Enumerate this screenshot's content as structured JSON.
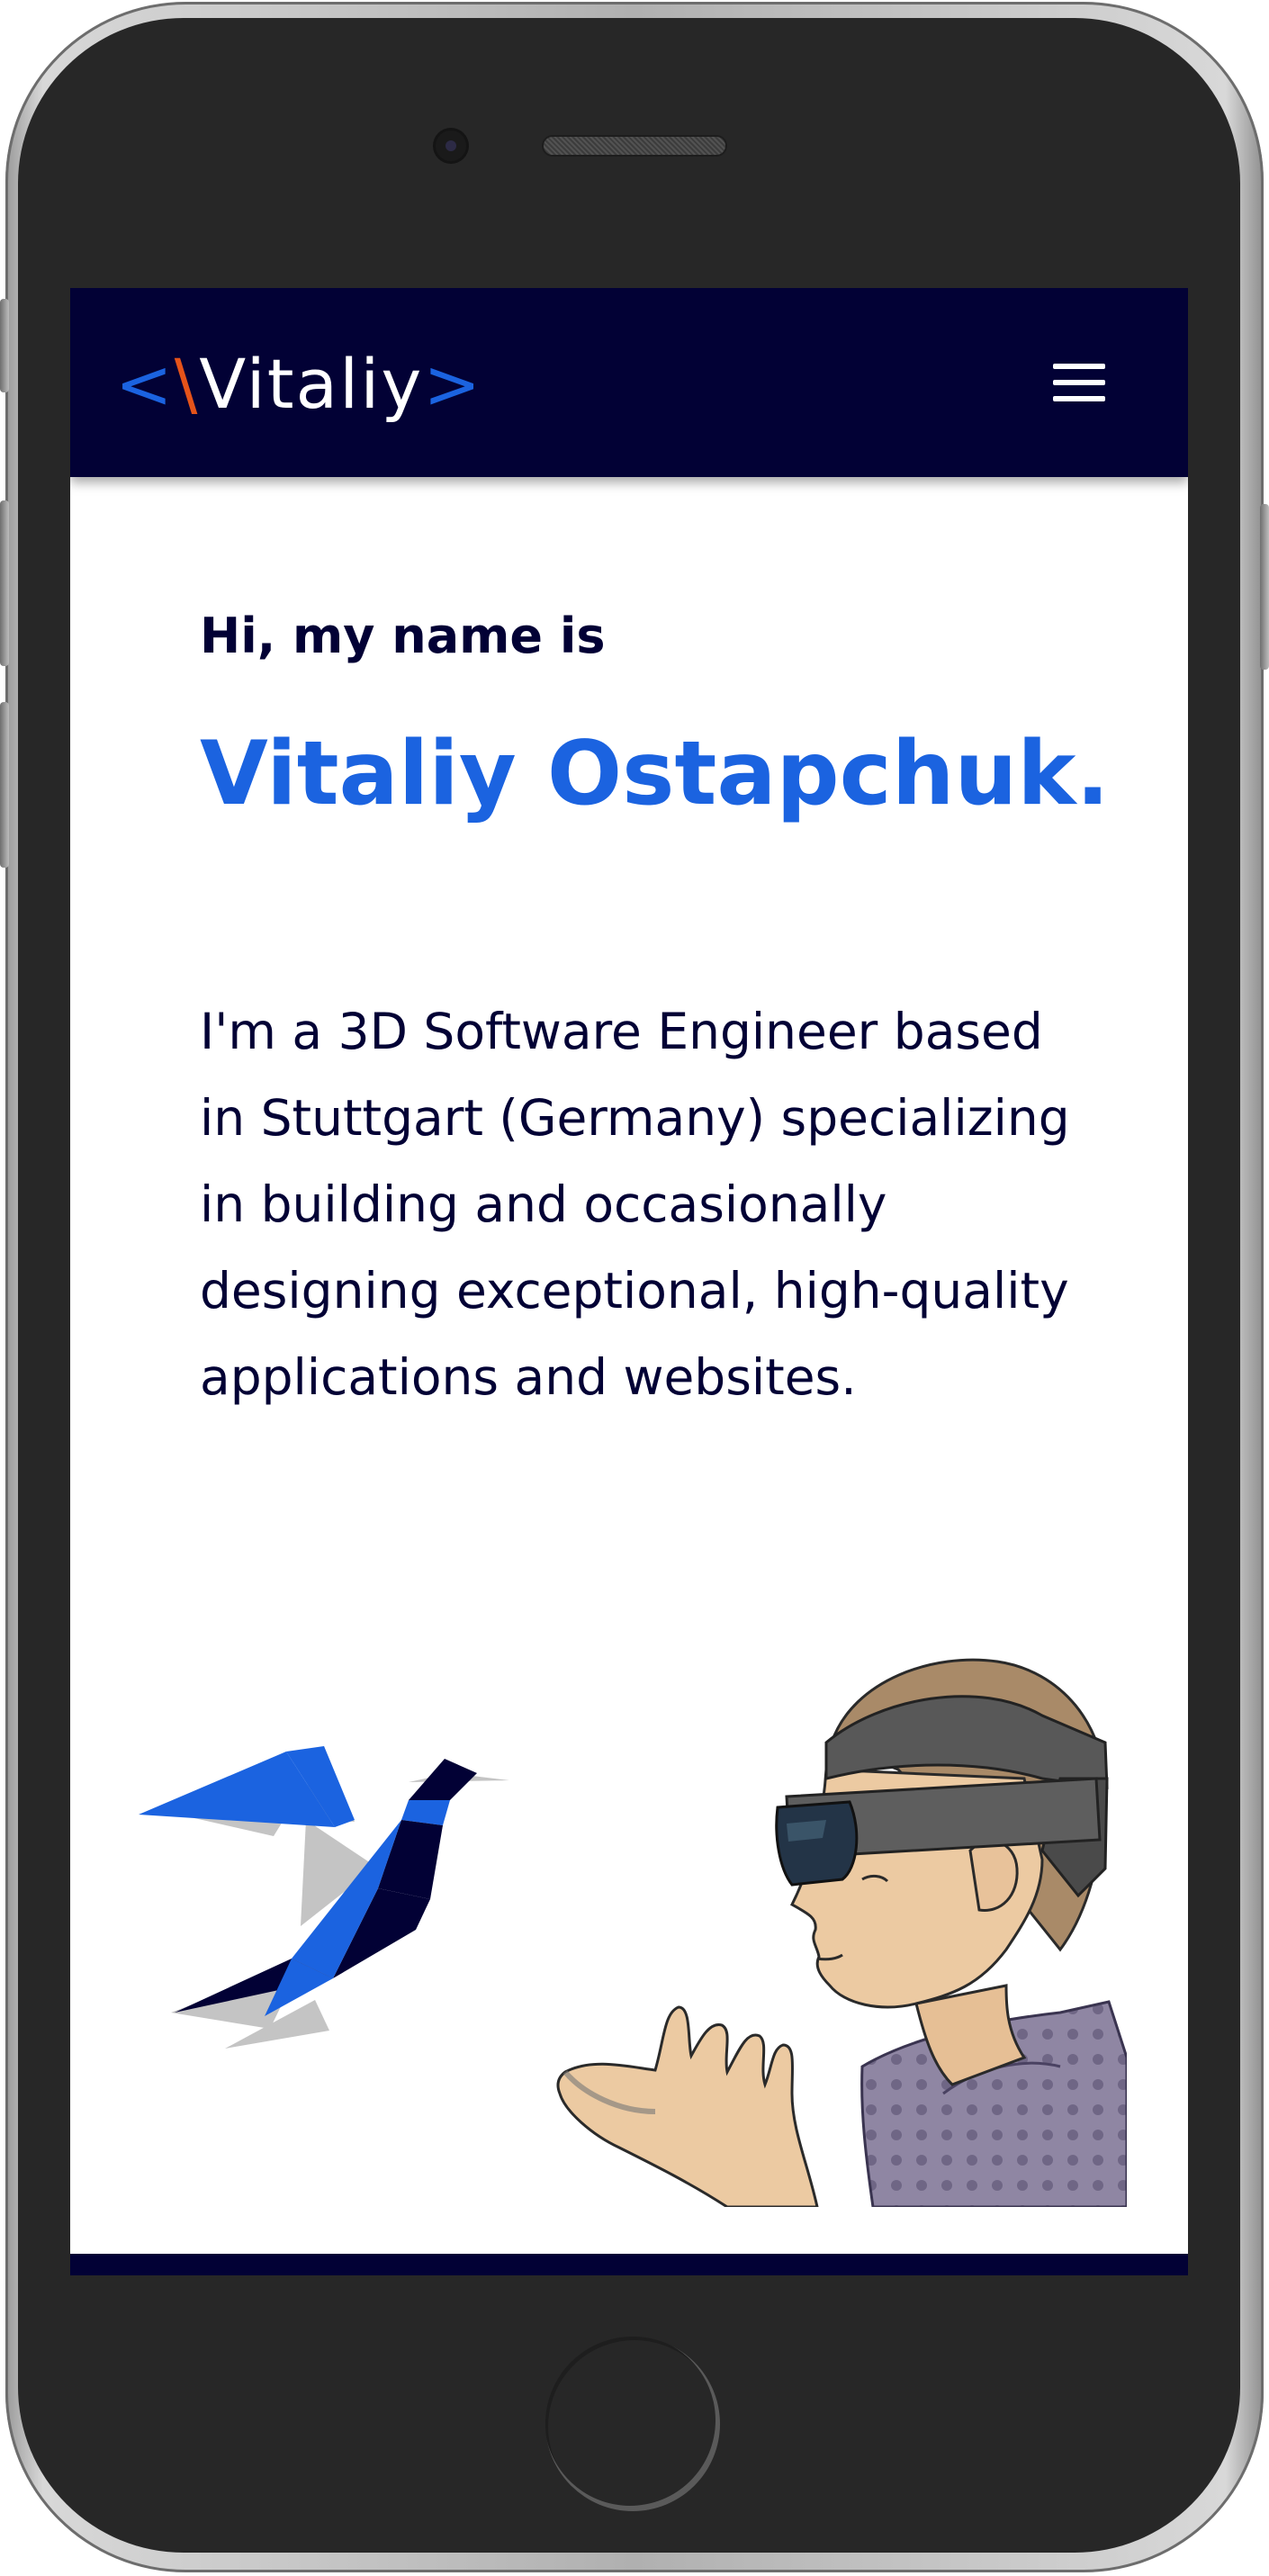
{
  "header": {
    "logo": {
      "open_bracket": "<",
      "slash": "\\",
      "name": "Vitaliy",
      "close_bracket": ">"
    },
    "menu_icon": "hamburger-menu-icon"
  },
  "hero": {
    "greeting": "Hi, my name is",
    "name": "Vitaliy Ostapchuk.",
    "bio": "I'm a 3D Software Engineer based in Stuttgart (Germany) specializing in building and occasionally designing exceptional, high-quality applications and websites."
  },
  "illustrations": {
    "bird": "origami-bird-illustration",
    "person": "person-with-ar-headset-illustration"
  },
  "colors": {
    "navbar": "#020135",
    "accent_blue": "#1b63e0",
    "accent_orange": "#e5531a",
    "text_dark": "#020135",
    "phone_body": "#272727"
  }
}
